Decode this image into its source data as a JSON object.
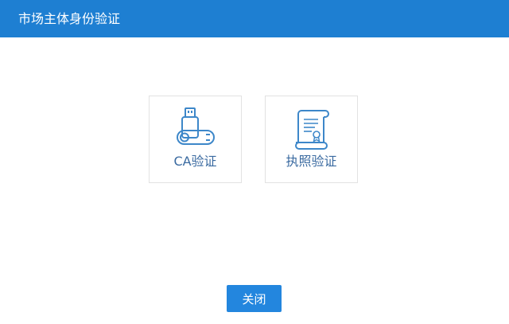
{
  "dialog": {
    "title": "市场主体身份验证"
  },
  "options": [
    {
      "label": "CA验证",
      "icon": "usb-key-icon"
    },
    {
      "label": "执照验证",
      "icon": "license-certificate-icon"
    }
  ],
  "footer": {
    "close_label": "关闭"
  },
  "colors": {
    "titlebar": "#1e7fd2",
    "button": "#2386de",
    "icon_stroke": "#3d87c9",
    "label_text": "#3a6aa0"
  }
}
